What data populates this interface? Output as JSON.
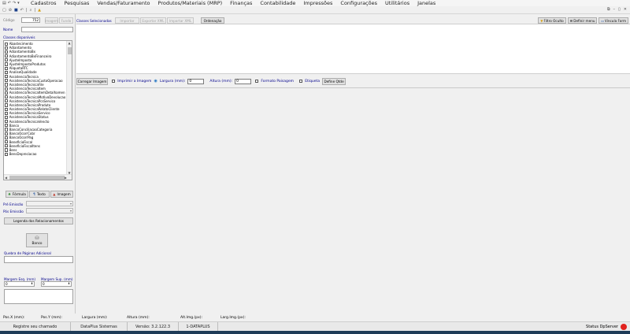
{
  "menu": {
    "items": [
      "Cadastros",
      "Pesquisas",
      "Vendas/Faturamento",
      "Produtos/Materiais (MRP)",
      "Finanças",
      "Contabilidade",
      "Impressões",
      "Configurações",
      "Utilitários",
      "Janelas"
    ]
  },
  "form": {
    "codigo_label": "Código",
    "codigo_value": "752",
    "nome_label": "Nome",
    "nome_value": "",
    "btn_imagem": "Imagem",
    "btn_fundo": "Fundo",
    "classes_disponiveis_label": "Classes disponíveis",
    "classes_selecionadas_label": "Classes Selecionadas",
    "btn_importar": "Importar",
    "btn_exportar_xml": "Exportar XML",
    "btn_importar_xml": "Importar XML",
    "btn_ordenacao": "Ordenação",
    "btn_formula": "Fórmula",
    "btn_texto": "Texto",
    "btn_imagem2": "Imagem",
    "pre_emissao_label": "Pré Emissão",
    "pos_emissao_label": "Pós Emissão",
    "btn_legenda": "Legenda dos Relacionamentos",
    "btn_banco": "Banco",
    "quebra_label": "Quebra de Páginas Adicional",
    "quebra_value": "",
    "margem_esq_label": "Margem Esq. (mm)",
    "margem_esq_value": "0",
    "margem_sup_label": "Margem Sup. (mm)",
    "margem_sup_value": "0"
  },
  "classes": [
    "Abastecimento",
    "Adiantamento",
    "AdiantamentoBx",
    "AdiantamentoBxFinanceiro",
    "AjusteImposto",
    "AjusteImpostoProdutos",
    "AliquotaRTC",
    "AnaliseQualidade",
    "AssistenciaTecnica",
    "AssistenciaTecnicaCustoOperacao",
    "AssistenciaTecnicaFile",
    "AssistenciaTecnicaItem",
    "AssistenciaTecnicaItemDetalhamen",
    "AssistenciaTecnicaMotivoDevolucao",
    "AssistenciaTecnicaPcsServico",
    "AssistenciaTecnicaProduto",
    "AssistenciaTecnicaRelatoCliente",
    "AssistenciaTecnicaServico",
    "AssistenciaTecnicaStatus",
    "AssistenciaTecnicaVencto",
    "Banco",
    "BancoConciliacaoCategoria",
    "BancoOcorrCobr",
    "BancoOcorrPag",
    "BeneficioFiscal",
    "BeneficioFiscalItens",
    "Bens",
    "BensDepreciacao"
  ],
  "toolbar_right": {
    "filtro_oculto": "Filtro Oculto",
    "definir_menu": "Definir menu",
    "vincula_form": "Vincula Form"
  },
  "options": {
    "btn_carregar": "Carregar Imagem",
    "imprimir_imagem": "Imprimir a Imagem",
    "largura_label": "Largura (mm):",
    "largura_value": "0",
    "altura_label": "Altura (mm):",
    "altura_value": "0",
    "formato_paisagem": "Formato Paisagem",
    "etiqueta": "Etiqueta",
    "btn_define_qtde": "Define Qtde"
  },
  "posbar": {
    "posx": "Pos.X (mm):",
    "posy": "Pos.Y (mm):",
    "largura": "Largura (mm):",
    "altura": "Altura (mm):",
    "altimg": "Alt.Img.(px):",
    "largimg": "Larg.Img.(px):"
  },
  "status": {
    "registre": "Registre seu chamado",
    "sistema": "DataPlus Sistemas",
    "versao": "Versão: 3.2.122.3",
    "empresa": "1-DATAPLUS",
    "server": "Status DpServer"
  }
}
